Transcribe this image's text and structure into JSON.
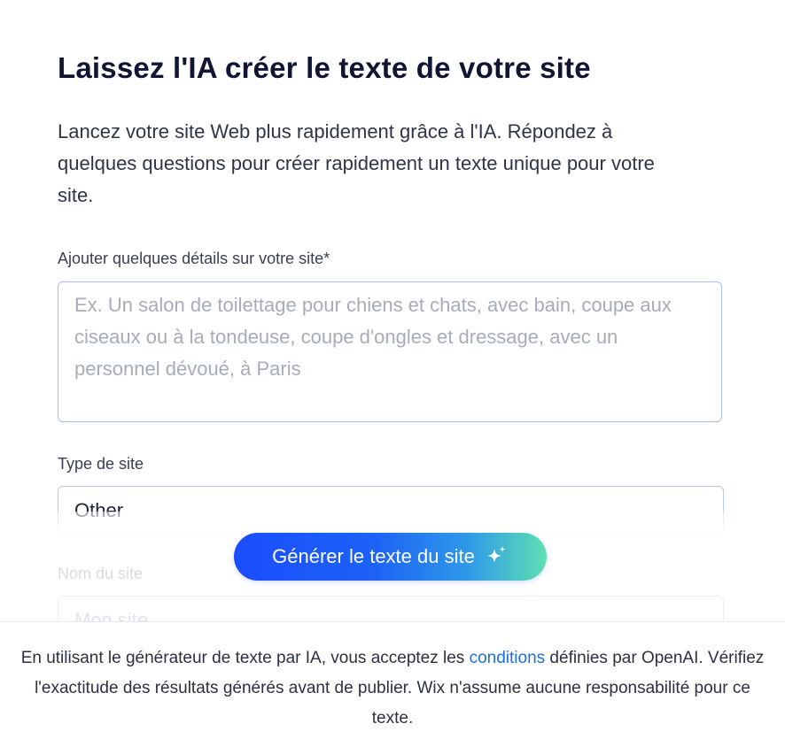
{
  "header": {
    "title": "Laissez l'IA créer le texte de votre site",
    "subtitle": "Lancez votre site Web plus rapidement grâce à l'IA. Répondez à quelques questions pour créer rapidement un texte unique pour votre site."
  },
  "form": {
    "details": {
      "label": "Ajouter quelques détails sur votre site*",
      "value": "",
      "placeholder": "Ex. Un salon de toilettage pour chiens et chats, avec bain, coupe aux ciseaux ou à la tondeuse, coupe d'ongles et dressage, avec un personnel dévoué, à Paris"
    },
    "site_type": {
      "label": "Type de site",
      "value": "Other"
    },
    "site_name": {
      "label": "Nom du site",
      "placeholder": "Mon site"
    }
  },
  "generate_button": {
    "label": "Générer le texte du site",
    "icon": "sparkle-icon"
  },
  "footer": {
    "text_before": "En utilisant le générateur de texte par IA, vous acceptez les ",
    "link_label": "conditions",
    "text_after": " définies par OpenAI. Vérifiez l'exactitude des résultats générés avant de publier. Wix n'assume aucune responsabilité pour ce texte."
  },
  "colors": {
    "title": "#0f1533",
    "link": "#1c6fe0",
    "button_gradient_start": "#1a4dff",
    "button_gradient_end": "#5de0b2",
    "input_border": "#a9bde3"
  }
}
